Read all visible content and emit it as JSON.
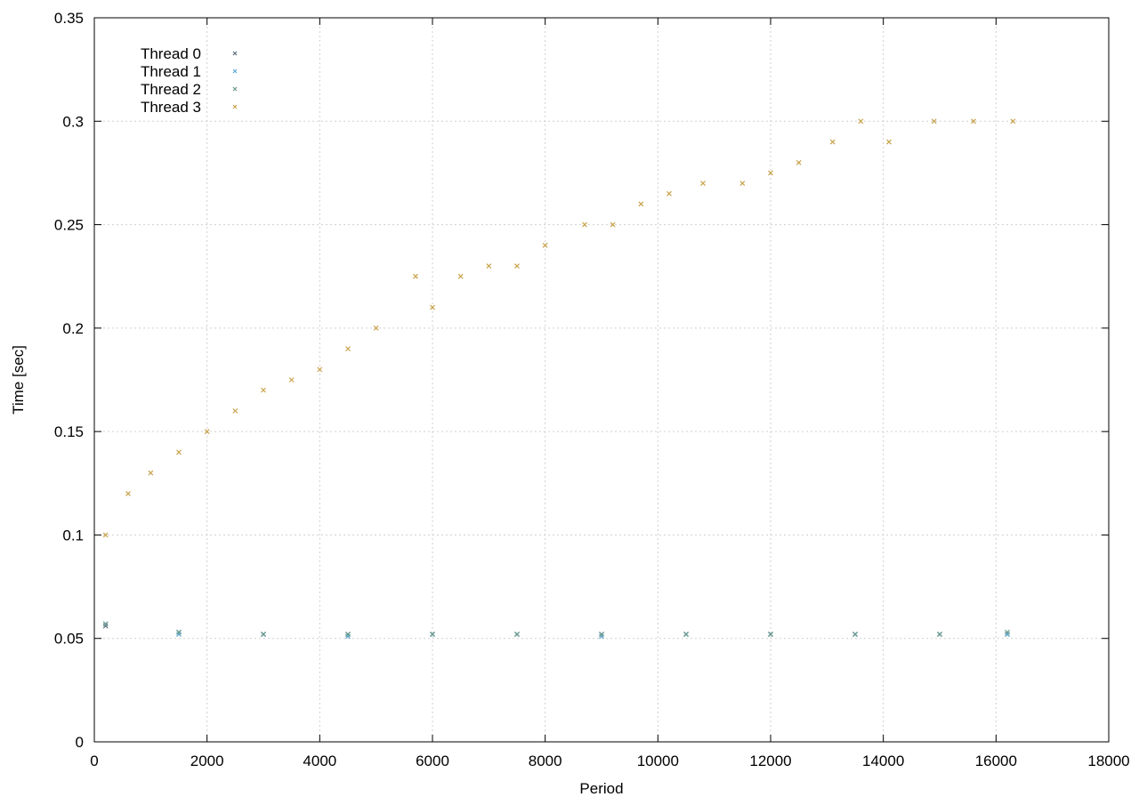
{
  "chart_data": {
    "type": "scatter",
    "title": "",
    "xlabel": "Period",
    "ylabel": "Time [sec]",
    "xlim": [
      0,
      18000
    ],
    "ylim": [
      0,
      0.35
    ],
    "x_ticks": [
      0,
      2000,
      4000,
      6000,
      8000,
      10000,
      12000,
      14000,
      16000,
      18000
    ],
    "y_ticks": [
      0,
      0.05,
      0.1,
      0.15,
      0.2,
      0.25,
      0.3,
      0.35
    ],
    "x_tick_labels": [
      "0",
      "2000",
      "4000",
      "6000",
      "8000",
      "10000",
      "12000",
      "14000",
      "16000",
      "18000"
    ],
    "y_tick_labels": [
      "0",
      "0.05",
      "0.1",
      "0.15",
      "0.2",
      "0.25",
      "0.3",
      "0.35"
    ],
    "grid": true,
    "legend_position": "top-left",
    "series": [
      {
        "name": "Thread 0",
        "color": "#5a6b7a",
        "x": [
          200,
          1500,
          3000,
          4500,
          6000,
          7500,
          9000,
          10500,
          12000,
          13500,
          15000,
          16200
        ],
        "y": [
          0.056,
          0.053,
          0.052,
          0.052,
          0.052,
          0.052,
          0.052,
          0.052,
          0.052,
          0.052,
          0.052,
          0.052
        ]
      },
      {
        "name": "Thread 1",
        "color": "#5fa8d3",
        "x": [
          200,
          1500,
          3000,
          4500,
          6000,
          7500,
          9000,
          10500,
          12000,
          13500,
          15000,
          16200
        ],
        "y": [
          0.057,
          0.052,
          0.052,
          0.051,
          0.052,
          0.052,
          0.051,
          0.052,
          0.052,
          0.052,
          0.052,
          0.052
        ]
      },
      {
        "name": "Thread 2",
        "color": "#6a9a8c",
        "x": [
          200,
          1500,
          3000,
          4500,
          6000,
          7500,
          9000,
          10500,
          12000,
          13500,
          15000,
          16200
        ],
        "y": [
          0.057,
          0.053,
          0.052,
          0.052,
          0.052,
          0.052,
          0.052,
          0.052,
          0.052,
          0.052,
          0.052,
          0.053
        ]
      },
      {
        "name": "Thread 3",
        "color": "#c9a24a",
        "x": [
          200,
          600,
          1000,
          1500,
          2000,
          2500,
          3000,
          3500,
          4000,
          4500,
          5000,
          5700,
          6000,
          6500,
          7000,
          7500,
          8000,
          8700,
          9200,
          9700,
          10200,
          10800,
          11500,
          12000,
          12500,
          13100,
          13600,
          14100,
          14900,
          15600,
          16300
        ],
        "y": [
          0.1,
          0.12,
          0.13,
          0.14,
          0.15,
          0.16,
          0.17,
          0.175,
          0.18,
          0.19,
          0.2,
          0.225,
          0.21,
          0.225,
          0.23,
          0.23,
          0.24,
          0.25,
          0.25,
          0.26,
          0.265,
          0.27,
          0.27,
          0.275,
          0.28,
          0.29,
          0.3,
          0.29,
          0.3,
          0.3,
          0.3
        ]
      }
    ]
  }
}
